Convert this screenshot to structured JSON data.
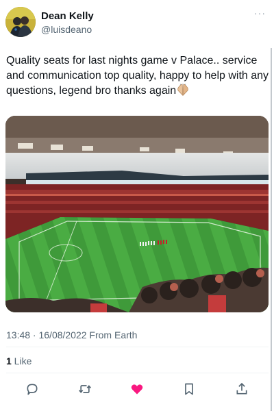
{
  "author": {
    "display_name": "Dean Kelly",
    "handle": "@luisdeano",
    "avatar_icon": "avatar-photo"
  },
  "menu": {
    "more_label": "···"
  },
  "tweet": {
    "text": "Quality seats for last nights game v Palace.. service and communication top quality, happy to help with any questions, legend bro thanks again",
    "emoji_icon": "praying-hands-emoji",
    "media_description_icon": "stadium-photo"
  },
  "meta": {
    "timestamp": "13:48 · 16/08/2022 From Earth"
  },
  "stats": {
    "likes_count": "1",
    "likes_label": " Like"
  },
  "actions": [
    {
      "name": "reply",
      "icon": "speech-bubble-icon"
    },
    {
      "name": "retweet",
      "icon": "retweet-arrows-icon"
    },
    {
      "name": "like",
      "icon": "heart-filled-icon",
      "active": true
    },
    {
      "name": "bookmark",
      "icon": "bookmark-icon"
    },
    {
      "name": "share",
      "icon": "share-upload-icon"
    }
  ],
  "colors": {
    "text_primary": "#0f1419",
    "text_secondary": "#536471",
    "like_active": "#f91880",
    "icon_default": "#536471",
    "pitch_green": "#3f9a3a",
    "stand_red": "#8c2a2a"
  }
}
